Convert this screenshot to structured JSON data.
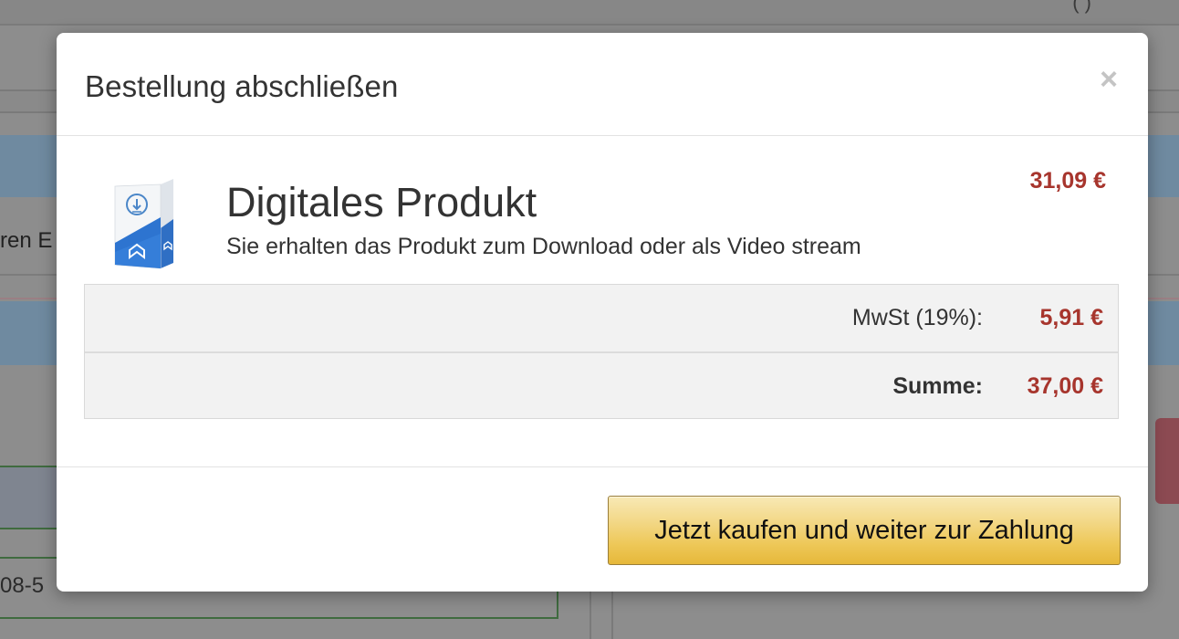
{
  "background": {
    "partial_text_left": "ren E",
    "partial_text_email": "08-5",
    "top_right_text": "(   )"
  },
  "modal": {
    "title": "Bestellung abschließen",
    "close_symbol": "×",
    "product": {
      "icon": "digital-product-box-icon",
      "title": "Digitales Produkt",
      "description": "Sie erhalten das Produkt zum Download oder als Video stream",
      "price": "31,09 €"
    },
    "summary": {
      "tax_label": "MwSt (19%):",
      "tax_value": "5,91 €",
      "total_label": "Summe:",
      "total_value": "37,00 €"
    },
    "buy_button_label": "Jetzt kaufen und weiter zur Zahlung"
  },
  "colors": {
    "price": "#a7352d",
    "overlay": "#8d8d8d",
    "button_gold": "#eec859"
  }
}
